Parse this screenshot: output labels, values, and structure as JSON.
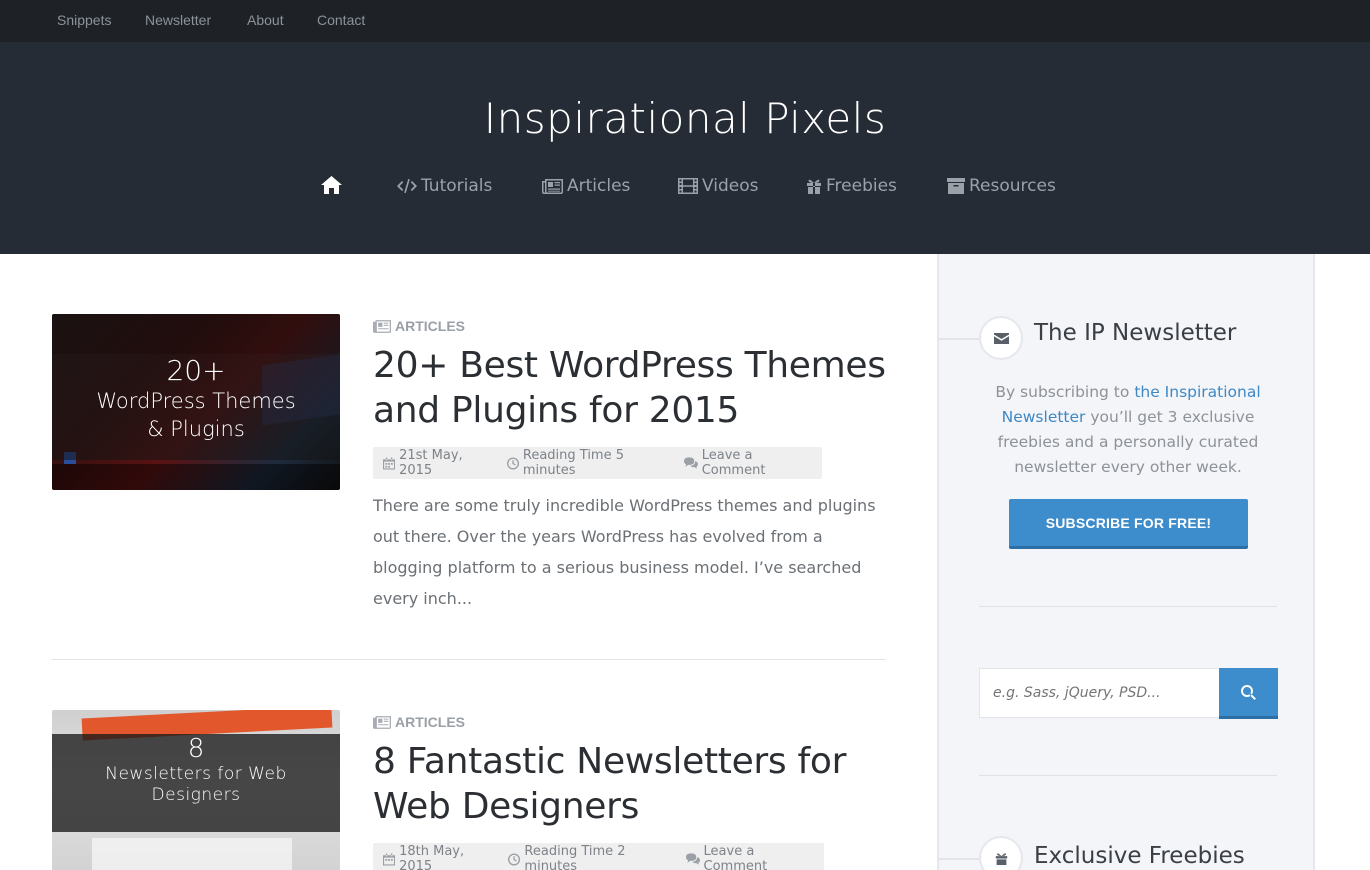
{
  "topbar": {
    "links": [
      "Snippets",
      "Newsletter",
      "About",
      "Contact"
    ]
  },
  "header": {
    "site_title": "Inspirational Pixels",
    "nav": {
      "home_icon": "home-icon",
      "items": [
        {
          "label": "Tutorials",
          "icon": "code-icon"
        },
        {
          "label": "Articles",
          "icon": "newspaper-icon"
        },
        {
          "label": "Videos",
          "icon": "film-icon"
        },
        {
          "label": "Freebies",
          "icon": "gift-icon"
        },
        {
          "label": "Resources",
          "icon": "archive-icon"
        }
      ]
    }
  },
  "posts": [
    {
      "thumb_big": "20+",
      "thumb_line1": "WordPress Themes",
      "thumb_line2": "& Plugins",
      "category": "ARTICLES",
      "title": "20+ Best WordPress Themes and Plugins for 2015",
      "date": "21st May, 2015",
      "reading_time": "Reading Time 5 minutes",
      "comment": "Leave a Comment",
      "excerpt": "There are some truly incredible WordPress themes and plugins out there. Over the years WordPress has evolved from a blogging platform to a serious business model. I’ve searched every inch..."
    },
    {
      "thumb_big": "8",
      "thumb_line1": "Newsletters for Web",
      "thumb_line2": "Designers",
      "category": "ARTICLES",
      "title": "8 Fantastic Newsletters for Web Designers",
      "date": "18th May, 2015",
      "reading_time": "Reading Time 2 minutes",
      "comment": "Leave a Comment"
    }
  ],
  "sidebar": {
    "newsletter": {
      "heading": "The IP Newsletter",
      "text_before": "By subscribing to ",
      "link_text": "the Inspirational Newsletter",
      "text_after": " you’ll get 3 exclusive freebies and a personally curated newsletter every other week.",
      "button_label": "SUBSCRIBE FOR FREE!"
    },
    "search": {
      "placeholder": "e.g. Sass, jQuery, PSD..."
    },
    "freebies": {
      "heading": "Exclusive Freebies"
    }
  },
  "colors": {
    "accent": "#3d8ccb",
    "header_bg": "#262c35",
    "topbar_bg": "#1e2227"
  }
}
